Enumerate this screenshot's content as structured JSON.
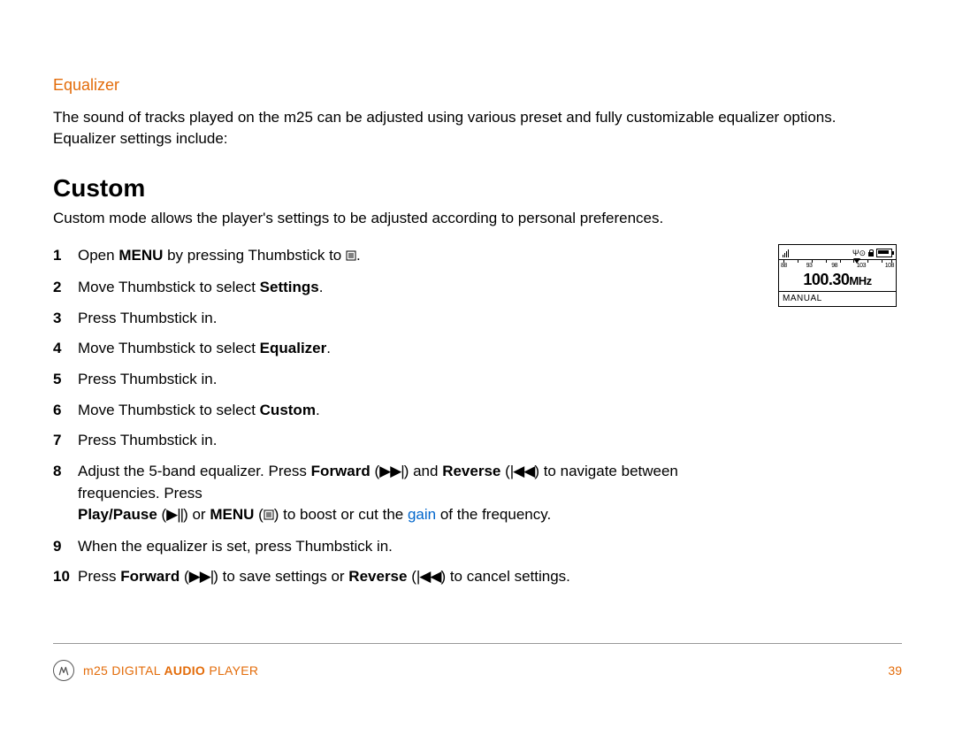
{
  "section_title": "Equalizer",
  "intro": "The sound of tracks played on the m25 can be adjusted using various preset and fully customizable equalizer options. Equalizer settings include:",
  "heading": "Custom",
  "subtext": "Custom mode allows the player's settings to be adjusted according to personal preferences.",
  "steps": [
    {
      "n": "1",
      "parts": [
        [
          "Open "
        ],
        [
          "b",
          "MENU"
        ],
        [
          " by pressing Thumbstick to "
        ],
        [
          "menu-icon"
        ],
        [
          "."
        ]
      ]
    },
    {
      "n": "2",
      "parts": [
        [
          "Move Thumbstick to select "
        ],
        [
          "b",
          "Settings"
        ],
        [
          "."
        ]
      ]
    },
    {
      "n": "3",
      "parts": [
        [
          "Press Thumbstick in."
        ]
      ]
    },
    {
      "n": "4",
      "parts": [
        [
          "Move Thumbstick to select "
        ],
        [
          "b",
          "Equalizer"
        ],
        [
          "."
        ]
      ]
    },
    {
      "n": "5",
      "parts": [
        [
          "Press Thumbstick in."
        ]
      ]
    },
    {
      "n": "6",
      "parts": [
        [
          "Move Thumbstick to select "
        ],
        [
          "b",
          "Custom"
        ],
        [
          "."
        ]
      ]
    },
    {
      "n": "7",
      "parts": [
        [
          "Press Thumbstick in."
        ]
      ]
    },
    {
      "n": "8",
      "parts": [
        [
          "Adjust the 5-band equalizer. Press "
        ],
        [
          "b",
          "Forward"
        ],
        [
          " ("
        ],
        [
          "ffwd-icon"
        ],
        [
          ") and "
        ],
        [
          "b",
          "Reverse"
        ],
        [
          " ("
        ],
        [
          "rev-icon"
        ],
        [
          ") to navigate between frequencies. Press "
        ],
        [
          "br"
        ],
        [
          "b",
          "Play/Pause"
        ],
        [
          " ("
        ],
        [
          "play-icon"
        ],
        [
          ") or "
        ],
        [
          "b",
          "MENU"
        ],
        [
          " ("
        ],
        [
          "menu-icon"
        ],
        [
          ") to boost or cut the "
        ],
        [
          "link",
          "gain"
        ],
        [
          " of the frequency."
        ]
      ]
    },
    {
      "n": "9",
      "parts": [
        [
          "When the equalizer is set, press Thumbstick in."
        ]
      ]
    },
    {
      "n": "10",
      "parts": [
        [
          "Press "
        ],
        [
          "b",
          "Forward"
        ],
        [
          " ("
        ],
        [
          "ffwd-icon"
        ],
        [
          ") to save settings or "
        ],
        [
          "b",
          "Reverse"
        ],
        [
          " ("
        ],
        [
          "rev-icon"
        ],
        [
          ") to cancel settings."
        ]
      ]
    }
  ],
  "device": {
    "scale_labels": [
      "88",
      "93",
      "98",
      "103",
      "108"
    ],
    "frequency": "100.30",
    "unit": "MHz",
    "mode": "MANUAL"
  },
  "footer": {
    "product_pre": "m25 DIGITAL ",
    "product_bold": "AUDIO",
    "product_post": " PLAYER",
    "page": "39"
  },
  "icons": {
    "ffwd": "▶▶|",
    "rev": "|◀◀",
    "play": "▶||"
  }
}
